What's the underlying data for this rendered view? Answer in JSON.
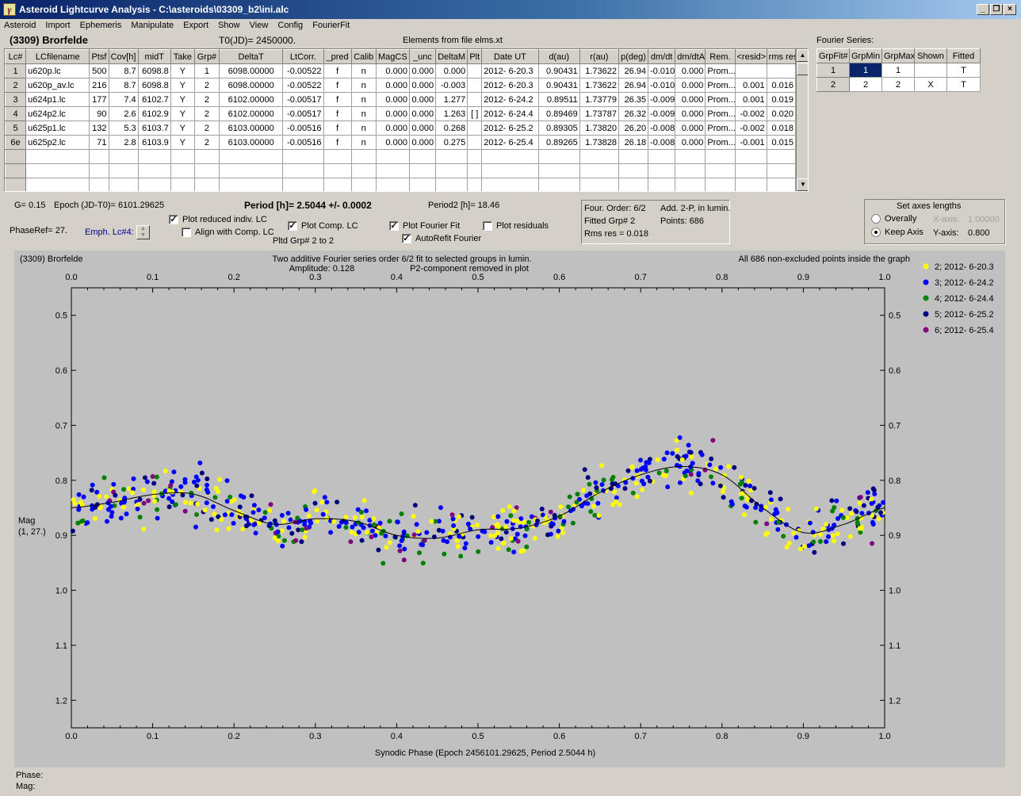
{
  "window": {
    "title": "Asteroid Lightcurve Analysis - C:\\asteroids\\03309_b2\\ini.alc"
  },
  "menu": [
    "Asteroid",
    "Import",
    "Ephemeris",
    "Manipulate",
    "Export",
    "Show",
    "View",
    "Config",
    "FourierFit"
  ],
  "header": {
    "asteroid": "(3309) Brorfelde",
    "t0": "T0(JD)= 2450000.",
    "elements": "Elements from file elms.xt"
  },
  "table": {
    "columns": [
      "Lc#",
      "LCfilename",
      "Ptsf",
      "Cov[h]",
      "midT",
      "Take",
      "Grp#",
      "DeltaT",
      "LtCorr.",
      "_pred",
      "Calib",
      "MagCS",
      "_unc",
      "DeltaM",
      "Plt",
      "Date UT",
      "d(au)",
      "r(au)",
      "p(deg)",
      "dm/dt",
      "dm/dtA",
      "Rem.",
      "<resid>",
      "rms res"
    ],
    "rows": [
      [
        "1",
        "u620p.lc",
        "500",
        "8.7",
        "6098.8",
        "Y",
        "1",
        "6098.00000",
        "-0.00522",
        "f",
        "n",
        "0.000",
        "0.000",
        "0.000",
        "",
        "2012- 6-20.3",
        "0.90431",
        "1.73622",
        "26.94",
        "-0.010",
        "0.000",
        "Prom...",
        "",
        ""
      ],
      [
        "2",
        "u620p_av.lc",
        "216",
        "8.7",
        "6098.8",
        "Y",
        "2",
        "6098.00000",
        "-0.00522",
        "f",
        "n",
        "0.000",
        "0.000",
        "-0.003",
        "",
        "2012- 6-20.3",
        "0.90431",
        "1.73622",
        "26.94",
        "-0.010",
        "0.000",
        "Prom...",
        "0.001",
        "0.016"
      ],
      [
        "3",
        "u624p1.lc",
        "177",
        "7.4",
        "6102.7",
        "Y",
        "2",
        "6102.00000",
        "-0.00517",
        "f",
        "n",
        "0.000",
        "0.000",
        "1.277",
        "",
        "2012- 6-24.2",
        "0.89511",
        "1.73779",
        "26.35",
        "-0.009",
        "0.000",
        "Prom...",
        "0.001",
        "0.019"
      ],
      [
        "4",
        "u624p2.lc",
        "90",
        "2.6",
        "6102.9",
        "Y",
        "2",
        "6102.00000",
        "-0.00517",
        "f",
        "n",
        "0.000",
        "0.000",
        "1.263",
        "[ ]",
        "2012- 6-24.4",
        "0.89469",
        "1.73787",
        "26.32",
        "-0.009",
        "0.000",
        "Prom...",
        "-0.002",
        "0.020"
      ],
      [
        "5",
        "u625p1.lc",
        "132",
        "5.3",
        "6103.7",
        "Y",
        "2",
        "6103.00000",
        "-0.00516",
        "f",
        "n",
        "0.000",
        "0.000",
        "0.268",
        "",
        "2012- 6-25.2",
        "0.89305",
        "1.73820",
        "26.20",
        "-0.008",
        "0.000",
        "Prom...",
        "-0.002",
        "0.018"
      ],
      [
        "6e",
        "u625p2.lc",
        "71",
        "2.8",
        "6103.9",
        "Y",
        "2",
        "6103.00000",
        "-0.00516",
        "f",
        "n",
        "0.000",
        "0.000",
        "0.275",
        "",
        "2012- 6-25.4",
        "0.89265",
        "1.73828",
        "26.18",
        "-0.008",
        "0.000",
        "Prom...",
        "-0.001",
        "0.015"
      ]
    ]
  },
  "fourier_series": {
    "label": "Fourier Series:",
    "columns": [
      "GrpFit#",
      "GrpMin",
      "GrpMax",
      "Shown",
      "Fitted"
    ],
    "rows": [
      [
        "1",
        "1",
        "1",
        "",
        "T"
      ],
      [
        "2",
        "2",
        "2",
        "X",
        "T"
      ]
    ]
  },
  "params": {
    "g": "G= 0.15",
    "epoch": "Epoch (JD-T0)= 6101.29625",
    "period": "Period [h]= 2.5044 +/- 0.0002",
    "period2": "Period2 [h]= 18.46",
    "phase_ref": "PhaseRef= 27.",
    "emph": "Emph. Lc#4:",
    "plot_reduced": "Plot reduced indiv. LC",
    "align_comp": "Align with Comp. LC",
    "plot_comp": "Plot Comp. LC",
    "pltd_grp": "Pltd Grp#  2  to  2",
    "plot_fourier": "Plot Fourier Fit",
    "autorefit": "AutoRefit Fourier",
    "plot_residuals": "Plot residuals"
  },
  "fit_info": {
    "order": "Four. Order:  6/2",
    "add": "Add. 2-P, in lumin.",
    "fitted": "Fitted Grp# 2",
    "points": "Points: 686",
    "rms": "Rms res     = 0.018"
  },
  "axes_box": {
    "title": "Set axes lengths",
    "overall": "Overally",
    "keep": "Keep Axis",
    "xaxis_label": "X-axis:",
    "xaxis_value": "1.00000",
    "yaxis_label": "Y-axis:",
    "yaxis_value": "0.800"
  },
  "status": {
    "phase": "Phase:",
    "mag": "Mag:"
  },
  "chart_data": {
    "type": "scatter",
    "title_left": "(3309) Brorfelde",
    "title_center": "Two additive Fourier series order 6/2 fit to selected groups in lumin.",
    "amplitude": "Amplitude: 0.128",
    "p2_note": "P2-component removed in plot",
    "title_right": "All 686 non-excluded points inside the graph",
    "xlabel": "Synodic Phase (Epoch 2456101.29625, Period 2.5044 h)",
    "ylabel": "Mag",
    "ylabel2": "(1, 27.)",
    "xlim": [
      0,
      1
    ],
    "ylim": [
      1.25,
      0.45
    ],
    "y_inverted": true,
    "xticks": [
      "0.0",
      "0.1",
      "0.2",
      "0.3",
      "0.4",
      "0.5",
      "0.6",
      "0.7",
      "0.8",
      "0.9",
      "1.0"
    ],
    "yticks": [
      "0.5",
      "0.6",
      "0.7",
      "0.8",
      "0.9",
      "1.0",
      "1.1",
      "1.2"
    ],
    "grid": false,
    "legend_position": "right",
    "fit_curve": {
      "x": [
        0,
        0.05,
        0.1,
        0.15,
        0.2,
        0.25,
        0.3,
        0.35,
        0.4,
        0.45,
        0.5,
        0.55,
        0.6,
        0.65,
        0.7,
        0.75,
        0.8,
        0.85,
        0.9,
        0.95,
        1.0
      ],
      "y": [
        0.85,
        0.84,
        0.826,
        0.825,
        0.855,
        0.88,
        0.87,
        0.875,
        0.9,
        0.905,
        0.89,
        0.887,
        0.865,
        0.822,
        0.79,
        0.775,
        0.79,
        0.85,
        0.895,
        0.88,
        0.85
      ]
    },
    "series": [
      {
        "name": "2; 2012- 6-20.3",
        "color": "#ffff00"
      },
      {
        "name": "3; 2012- 6-24.2",
        "color": "#0000ff"
      },
      {
        "name": "4; 2012- 6-24.4",
        "color": "#008000"
      },
      {
        "name": "5; 2012- 6-25.2",
        "color": "#000080"
      },
      {
        "name": "6; 2012- 6-25.4",
        "color": "#800080"
      }
    ],
    "scatter": {
      "point_count": 686,
      "noise_mag": 0.022
    }
  }
}
